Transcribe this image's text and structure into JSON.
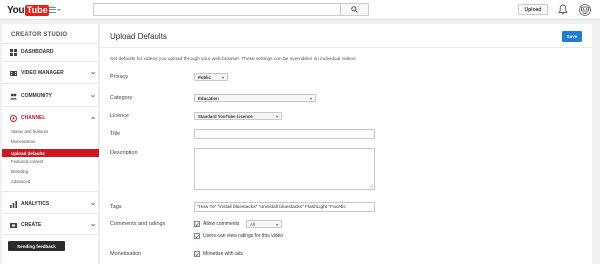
{
  "header": {
    "logo_you": "You",
    "logo_tube": "Tube",
    "logo_suffix": "CA",
    "search_placeholder": "",
    "upload_label": "Upload"
  },
  "sidebar": {
    "title": "CREATOR STUDIO",
    "items": {
      "dashboard": "DASHBOARD",
      "video_manager": "VIDEO MANAGER",
      "community": "COMMUNITY",
      "channel": "CHANNEL",
      "analytics": "ANALYTICS",
      "create": "CREATE"
    },
    "channel_sub": {
      "status": "Status and features",
      "monetisation": "Monetisation",
      "upload_defaults": "Upload defaults",
      "featured": "Featured content",
      "branding": "Branding",
      "advanced": "Advanced"
    },
    "feedback_label": "Sending feedback"
  },
  "main": {
    "title": "Upload Defaults",
    "save_label": "Save",
    "description": "Set defaults for videos you upload through your web browser. These settings can be overridden on individual videos.",
    "privacy": {
      "label": "Privacy",
      "value": "Public"
    },
    "category": {
      "label": "Category",
      "value": "Education"
    },
    "licence": {
      "label": "Licence",
      "value": "Standard YouTube Licence"
    },
    "title_field": {
      "label": "Title",
      "value": ""
    },
    "description_field": {
      "label": "Description",
      "value": ""
    },
    "tags": {
      "label": "Tags",
      "value": "\"How To\" \"install  bluestacks\" \"uninstall bluestacks\" FlashLight \"Facebc"
    },
    "comments": {
      "label": "Comments and ratings",
      "allow_comments": "Allow comments",
      "allow_value": "All",
      "ratings": "Users can view ratings for this video"
    },
    "monetisation": {
      "label": "Monetisation",
      "option": "Monetise with ads"
    }
  },
  "colors": {
    "brand_red": "#e62117",
    "active_red": "#cc181e",
    "save_blue": "#1f7dcf"
  }
}
